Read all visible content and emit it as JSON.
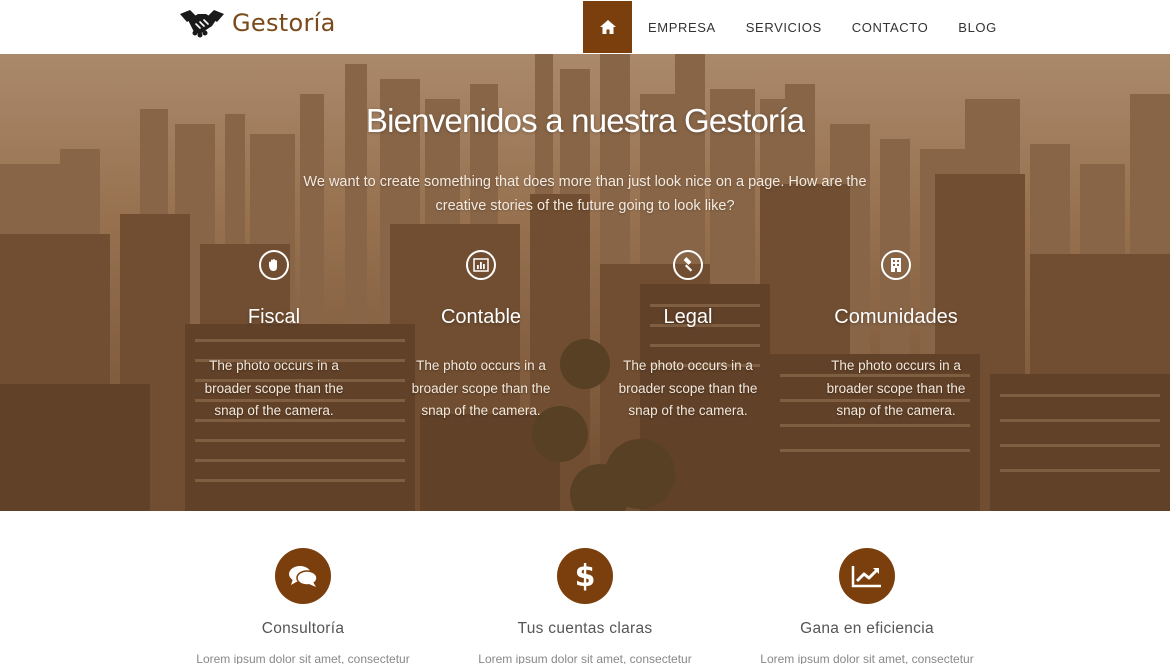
{
  "header": {
    "logo_text": "Gestoría",
    "logo_icon": "handshake-icon",
    "nav": {
      "home_icon": "home-icon",
      "items": [
        "EMPRESA",
        "SERVICIOS",
        "CONTACTO",
        "BLOG"
      ]
    }
  },
  "colors": {
    "brand": "#7a3f0c",
    "hero_tint": "#8a6240",
    "text_muted": "#888888"
  },
  "hero": {
    "title": "Bienvenidos a nuestra Gestoría",
    "subtitle": "We want to create something that does more than just look nice on a page. How are the creative stories of the future going to look like?",
    "features": [
      {
        "title": "Fiscal",
        "icon": "hand-icon",
        "text": "The photo occurs in a broader scope than the snap of the camera."
      },
      {
        "title": "Contable",
        "icon": "bar-chart-icon",
        "text": "The photo occurs in a broader scope than the snap of the camera."
      },
      {
        "title": "Legal",
        "icon": "gavel-icon",
        "text": "The photo occurs in a broader scope than the snap of the camera."
      },
      {
        "title": "Comunidades",
        "icon": "building-icon",
        "text": "The photo occurs in a broader scope than the snap of the camera."
      }
    ]
  },
  "services": [
    {
      "title": "Consultoría",
      "icon": "comments-icon",
      "text": "Lorem ipsum dolor sit amet, consectetur"
    },
    {
      "title": "Tus cuentas claras",
      "icon": "dollar-icon",
      "text": "Lorem ipsum dolor sit amet, consectetur"
    },
    {
      "title": "Gana en eficiencia",
      "icon": "line-chart-icon",
      "text": "Lorem ipsum dolor sit amet, consectetur"
    }
  ]
}
